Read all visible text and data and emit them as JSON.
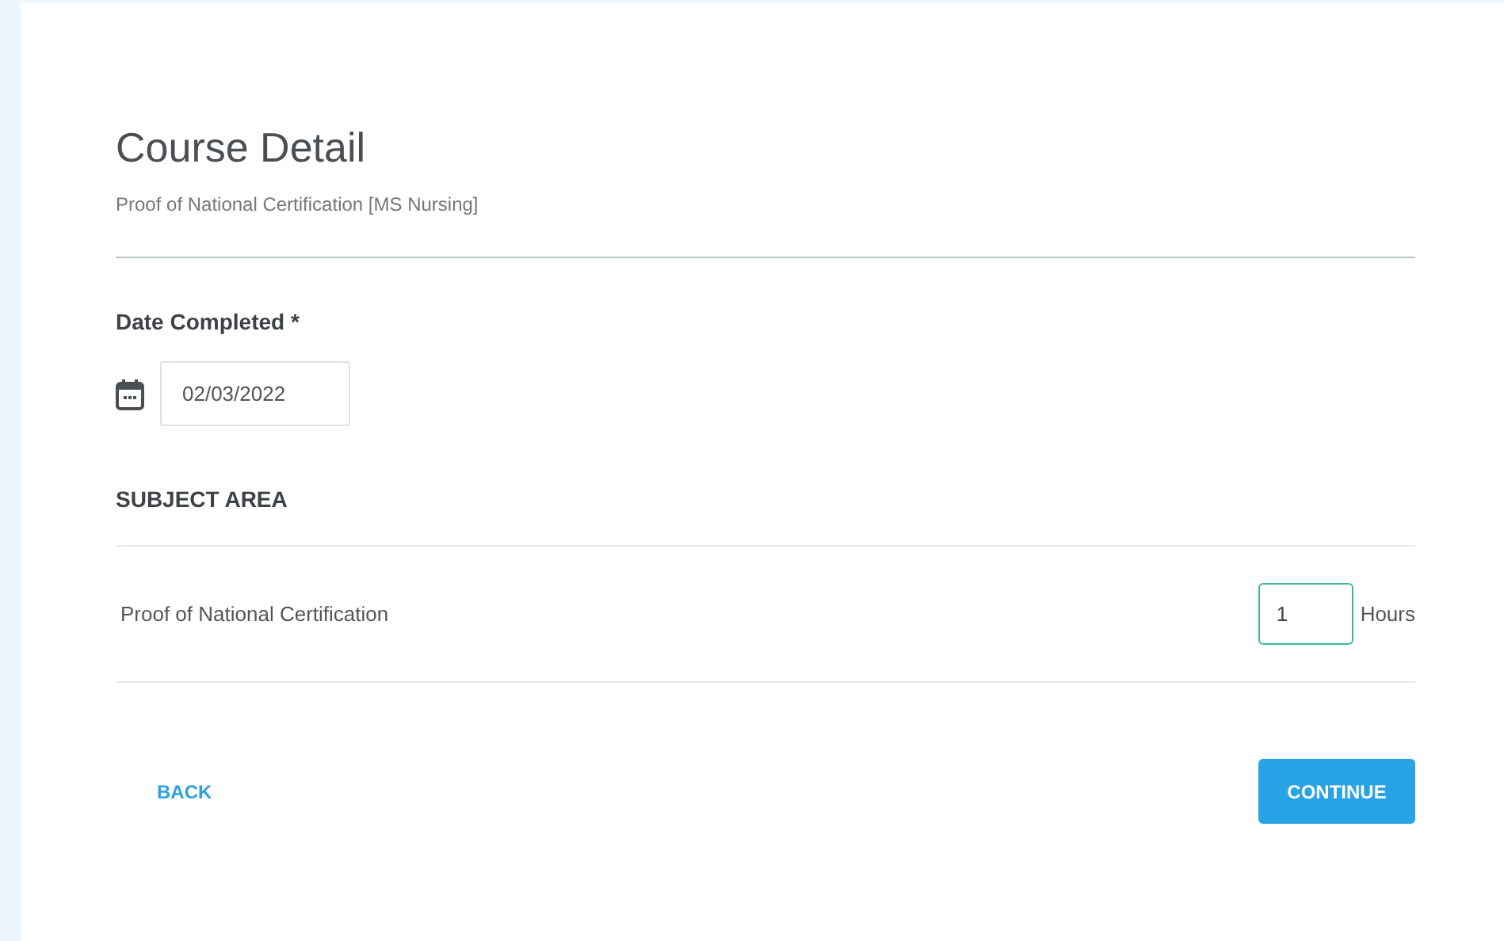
{
  "title": "Course Detail",
  "subtitle": "Proof of National Certification [MS Nursing]",
  "date_field": {
    "label": "Date Completed *",
    "value": "02/03/2022"
  },
  "subject_area": {
    "heading": "SUBJECT AREA",
    "rows": [
      {
        "name": "Proof of National Certification",
        "hours": "1",
        "unit": "Hours"
      }
    ]
  },
  "buttons": {
    "back": "BACK",
    "continue": "CONTINUE"
  }
}
